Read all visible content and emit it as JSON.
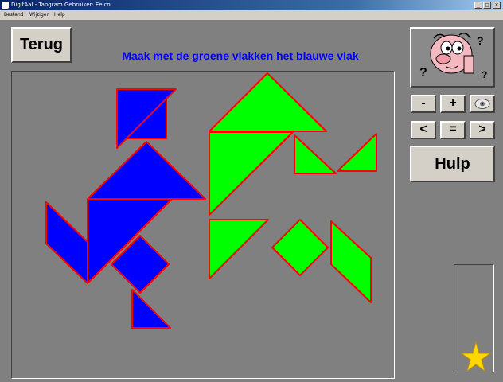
{
  "window": {
    "title": "DigitAal - Tangram  Gebruiker: Eelco",
    "minimize_label": "_",
    "maximize_label": "□",
    "close_label": "×"
  },
  "menu": [
    "Bestand",
    "Wijzigen",
    "Help"
  ],
  "buttons": {
    "back": "Terug",
    "zoom_out": "-",
    "zoom_in": "+",
    "previous": "<",
    "equals": "=",
    "next": ">",
    "help": "Hulp"
  },
  "instruction": "Maak met de groene vlakken het blauwe vlak",
  "colors": {
    "target_fill": "#0000ff",
    "piece_fill": "#00ff00",
    "piece_outline": "#ff0000",
    "instruction_text": "#0000ff",
    "star": "#ffd700"
  },
  "icons": {
    "mascot": "thinking-face-icon",
    "hint": "eye-icon",
    "score": "star-icon"
  }
}
